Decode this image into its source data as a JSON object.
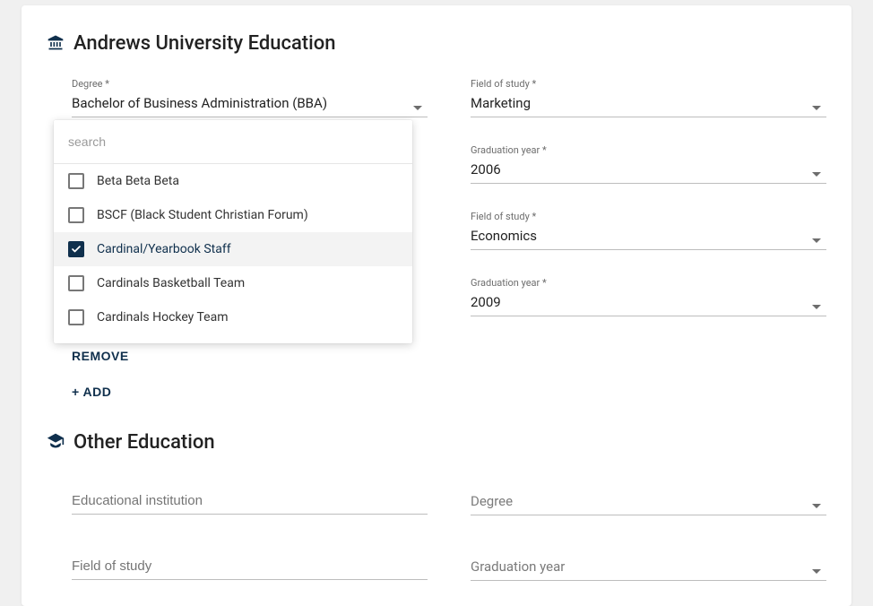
{
  "section1": {
    "title": "Andrews University Education",
    "degree": {
      "label": "Degree *",
      "value": "Bachelor of Business Administration (BBA)"
    },
    "fieldOfStudy1": {
      "label": "Field of study *",
      "value": "Marketing"
    },
    "gradYear1": {
      "label": "Graduation year *",
      "value": "2006"
    },
    "fieldOfStudy2": {
      "label": "Field of study *",
      "value": "Economics"
    },
    "gradYear2": {
      "label": "Graduation year *",
      "value": "2009"
    },
    "removeLabel": "REMOVE",
    "addLabel": "+ ADD"
  },
  "dropdown": {
    "searchPlaceholder": "search",
    "options": [
      {
        "label": "Beta Beta Beta",
        "checked": false
      },
      {
        "label": "BSCF (Black Student Christian Forum)",
        "checked": false
      },
      {
        "label": "Cardinal/Yearbook Staff",
        "checked": true
      },
      {
        "label": "Cardinals Basketball Team",
        "checked": false
      },
      {
        "label": "Cardinals Hockey Team",
        "checked": false
      }
    ]
  },
  "section2": {
    "title": "Other Education",
    "institutionPlaceholder": "Educational institution",
    "degreePlaceholder": "Degree",
    "fieldPlaceholder": "Field of study",
    "gradYearPlaceholder": "Graduation year"
  }
}
